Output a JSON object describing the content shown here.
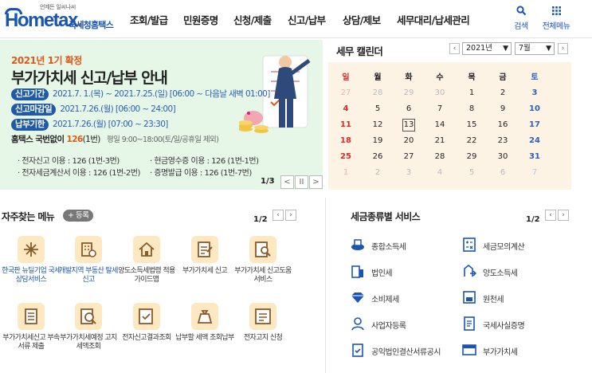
{
  "header": {
    "logo_tag": "언제든 일씨나씨",
    "logo_word_main": "Hometax",
    "logo_word_dot": ".",
    "logo_sub": "국세청홈택스",
    "nav": [
      "조회/발급",
      "민원증명",
      "신청/제출",
      "신고/납부",
      "상담/제보",
      "세무대리/납세관리"
    ],
    "search_label": "검색",
    "menu_label": "전체메뉴"
  },
  "banner": {
    "year": "2021년 1기 확정",
    "title": "부가가치세 신고/납부 안내",
    "rows": [
      {
        "pill": "신고기간",
        "text": "2021.7. 1.(목) ~ 2021.7.25.(일) [06:00 ~ 다음날 새벽 01:00]"
      },
      {
        "pill": "신고마감일",
        "text": "2021.7.26.(월) [06:00 ~ 24:00]"
      },
      {
        "pill": "납부기한",
        "text": "2021.7.26.(월) [07:00 ~ 23:30]"
      }
    ],
    "call_prefix": "홈택스 국번없이 ",
    "call_number": "126",
    "call_suffix": "(1번)",
    "call_hours": "평일 9:00~18:00(토/일/공휴일 제외)",
    "stats": [
      "· 전자신고 이용 : 126 (1번-3번)",
      "· 현금영수증 이용 : 126 (1번-1번)",
      "· 전자세금계산서 이용 : 126 (1번-2번)",
      "· 증명발급 이용 : 126 (1번-7번)"
    ],
    "pager": "1/3",
    "pager_prev": "<",
    "pager_pause": "II",
    "pager_next": ">"
  },
  "calendar": {
    "title": "세무 캘린더",
    "year": "2021년",
    "month": "7월",
    "weekdays": [
      "일",
      "월",
      "화",
      "수",
      "목",
      "금",
      "토"
    ],
    "weeks": [
      [
        "27",
        "28",
        "29",
        "30",
        "1",
        "2",
        "3"
      ],
      [
        "4",
        "5",
        "6",
        "7",
        "8",
        "9",
        "10"
      ],
      [
        "11",
        "12",
        "13",
        "14",
        "15",
        "16",
        "17"
      ],
      [
        "18",
        "19",
        "20",
        "21",
        "22",
        "23",
        "24"
      ],
      [
        "25",
        "26",
        "27",
        "28",
        "29",
        "30",
        "31"
      ],
      [
        "1",
        "2",
        "3",
        "4",
        "5",
        "6",
        "7"
      ]
    ],
    "today": "13"
  },
  "favorites": {
    "title": "자주찾는 메뉴",
    "add_label": "+ 등록",
    "pager": "1/2",
    "items": [
      {
        "label": "한국판 뉴딜기업 국세상담서비스",
        "icon": "sparkle-icon"
      },
      {
        "label": "개발지역 부동산 탈세신고",
        "icon": "building-icon"
      },
      {
        "label": "양도소득세법령 적용가이드맵",
        "icon": "house-icon"
      },
      {
        "label": "부가가치세 신고",
        "icon": "vat-doc-icon"
      },
      {
        "label": "부가가치세 신고도움 서비스",
        "icon": "search-doc-icon"
      },
      {
        "label": "부가가치세신고 부속서류 제출",
        "icon": "document-icon"
      },
      {
        "label": "부가가치세예정 고지세액조회",
        "icon": "search-won-icon"
      },
      {
        "label": "전자신고결과조회",
        "icon": "search-check-icon"
      },
      {
        "label": "납부할 세액 조회납부",
        "icon": "money-bag-icon"
      },
      {
        "label": "전자고지 신청",
        "icon": "notice-icon"
      }
    ]
  },
  "services": {
    "title": "세금종류별 서비스",
    "pager": "1/2",
    "items": [
      {
        "label": "종합소득세",
        "icon": "income-tax-icon"
      },
      {
        "label": "세금모의계산",
        "icon": "calculator-icon"
      },
      {
        "label": "법인세",
        "icon": "corporate-tax-icon"
      },
      {
        "label": "양도소득세",
        "icon": "transfer-tax-icon"
      },
      {
        "label": "소비제세",
        "icon": "diamond-icon"
      },
      {
        "label": "원천세",
        "icon": "withholding-tax-icon"
      },
      {
        "label": "사업자등록",
        "icon": "person-icon"
      },
      {
        "label": "국세사실증명",
        "icon": "certificate-icon"
      },
      {
        "label": "공익법인결산서류공시",
        "icon": "checklist-icon"
      },
      {
        "label": "부가가치세",
        "icon": "vat-icon"
      }
    ]
  },
  "colors": {
    "brand": "#1a56b0",
    "accent": "#e05a1a",
    "banner_bg": "#e6f6e7",
    "calendar_bg": "#fdf3e4",
    "sunday": "#d62b2b",
    "saturday": "#2b5fb8"
  }
}
